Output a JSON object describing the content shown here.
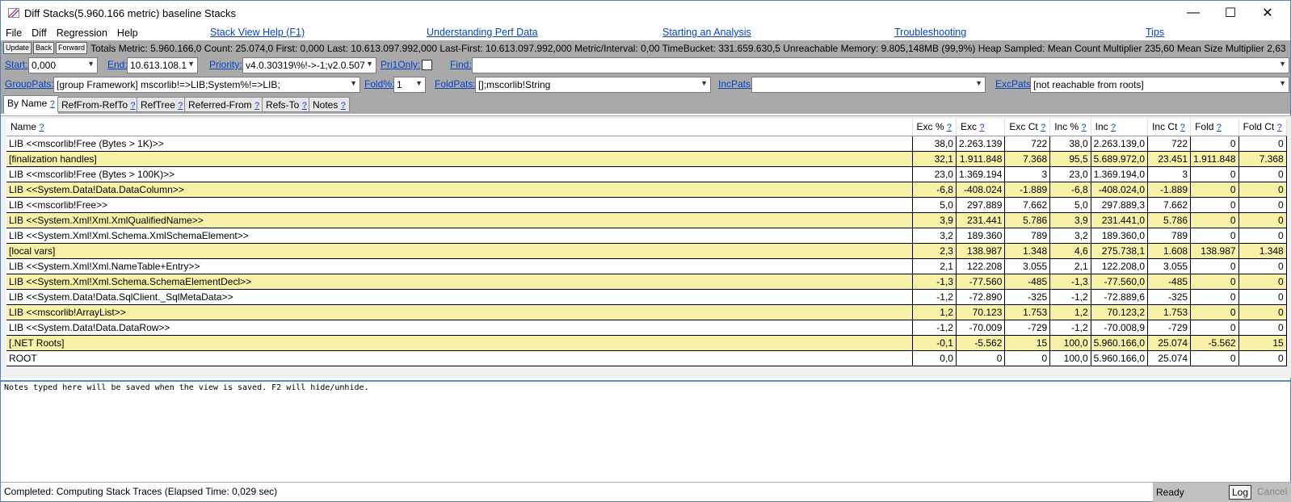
{
  "window": {
    "title": "Diff  Stacks(5.960.166 metric) baseline  Stacks",
    "minimize": "—",
    "maximize": "☐",
    "close": "✕"
  },
  "menu": [
    {
      "label": "File",
      "u": "F"
    },
    {
      "label": "Diff",
      "u": "D"
    },
    {
      "label": "Regression",
      "u": "R"
    },
    {
      "label": "Help",
      "u": "H"
    }
  ],
  "toplinks": [
    "Stack View Help (F1)",
    "Understanding Perf Data",
    "Starting an Analysis",
    "Troubleshooting",
    "Tips"
  ],
  "toolbar": {
    "update": "Update",
    "back": "Back",
    "forward": "Forward",
    "totals": "Totals Metric: 5.960.166,0  Count: 25.074,0  First: 0,000 Last: 10.613.097.992,000  Last-First: 10.613.097.992,000  Metric/Interval: 0,00  TimeBucket: 331.659.630,5  Unreachable Memory: 9.805,148MB (99,9%) Heap Sampled: Mean Count Multiplier 235,60 Mean Size Multiplier 2,63"
  },
  "filters": {
    "start_label": "Start:",
    "start_value": "0,000",
    "end_label": "End:",
    "end_value": "10.613.108.1",
    "priority_label": "Priority:",
    "priority_value": "v4.0.30319\\%!->-1;v2.0.507",
    "pri1only_label": "Pri1Only:",
    "find_label": "Find:",
    "find_value": "",
    "grouppats_label": "GroupPats:",
    "grouppats_value": "[group Framework] mscorlib!=>LIB;System%!=>LIB;",
    "fold_label": "Fold%:",
    "fold_value": "1",
    "foldpats_label": "FoldPats:",
    "foldpats_value": "[];mscorlib!String",
    "incpats_label": "IncPats:",
    "incpats_value": "",
    "excpats_label": "ExcPats:",
    "excpats_value": "[not reachable from roots]"
  },
  "tabs": [
    "By Name",
    "RefFrom-RefTo",
    "RefTree",
    "Referred-From",
    "Refs-To",
    "Notes"
  ],
  "columns": [
    "Name",
    "Exc %",
    "Exc",
    "Exc Ct",
    "Inc %",
    "Inc",
    "Inc Ct",
    "Fold",
    "Fold Ct"
  ],
  "help_mark": "?",
  "rows": [
    [
      "LIB <<mscorlib!Free (Bytes > 1K)>>",
      "38,0",
      "2.263.139",
      "722",
      "38,0",
      "2.263.139,0",
      "722",
      "0",
      "0"
    ],
    [
      "[finalization handles]",
      "32,1",
      "1.911.848",
      "7.368",
      "95,5",
      "5.689.972,0",
      "23.451",
      "1.911.848",
      "7.368"
    ],
    [
      "LIB <<mscorlib!Free (Bytes > 100K)>>",
      "23,0",
      "1.369.194",
      "3",
      "23,0",
      "1.369.194,0",
      "3",
      "0",
      "0"
    ],
    [
      "LIB <<System.Data!Data.DataColumn>>",
      "-6,8",
      "-408.024",
      "-1.889",
      "-6,8",
      "-408.024,0",
      "-1.889",
      "0",
      "0"
    ],
    [
      "LIB <<mscorlib!Free>>",
      "5,0",
      "297.889",
      "7.662",
      "5,0",
      "297.889,3",
      "7.662",
      "0",
      "0"
    ],
    [
      "LIB <<System.Xml!Xml.XmlQualifiedName>>",
      "3,9",
      "231.441",
      "5.786",
      "3,9",
      "231.441,0",
      "5.786",
      "0",
      "0"
    ],
    [
      "LIB <<System.Xml!Xml.Schema.XmlSchemaElement>>",
      "3,2",
      "189.360",
      "789",
      "3,2",
      "189.360,0",
      "789",
      "0",
      "0"
    ],
    [
      "[local vars]",
      "2,3",
      "138.987",
      "1.348",
      "4,6",
      "275.738,1",
      "1.608",
      "138.987",
      "1.348"
    ],
    [
      "LIB <<System.Xml!Xml.NameTable+Entry>>",
      "2,1",
      "122.208",
      "3.055",
      "2,1",
      "122.208,0",
      "3.055",
      "0",
      "0"
    ],
    [
      "LIB <<System.Xml!Xml.Schema.SchemaElementDecl>>",
      "-1,3",
      "-77.560",
      "-485",
      "-1,3",
      "-77.560,0",
      "-485",
      "0",
      "0"
    ],
    [
      "LIB <<System.Data!Data.SqlClient._SqlMetaData>>",
      "-1,2",
      "-72.890",
      "-325",
      "-1,2",
      "-72.889,6",
      "-325",
      "0",
      "0"
    ],
    [
      "LIB <<mscorlib!ArrayList>>",
      "1,2",
      "70.123",
      "1.753",
      "1,2",
      "70.123,2",
      "1.753",
      "0",
      "0"
    ],
    [
      "LIB <<System.Data!Data.DataRow>>",
      "-1,2",
      "-70.009",
      "-729",
      "-1,2",
      "-70.008,9",
      "-729",
      "0",
      "0"
    ],
    [
      "[.NET Roots]",
      "-0,1",
      "-5.562",
      "15",
      "100,0",
      "5.960.166,0",
      "25.074",
      "-5.562",
      "15"
    ],
    [
      "ROOT",
      "0,0",
      "0",
      "0",
      "100,0",
      "5.960.166,0",
      "25.074",
      "0",
      "0"
    ]
  ],
  "notes_text": "Notes typed here will be saved when the view is saved. F2 will hide/unhide.",
  "status": {
    "text": "Completed: Computing Stack Traces   (Elapsed Time: 0,029 sec)",
    "ready": "Ready",
    "log": "Log",
    "cancel": "Cancel"
  }
}
